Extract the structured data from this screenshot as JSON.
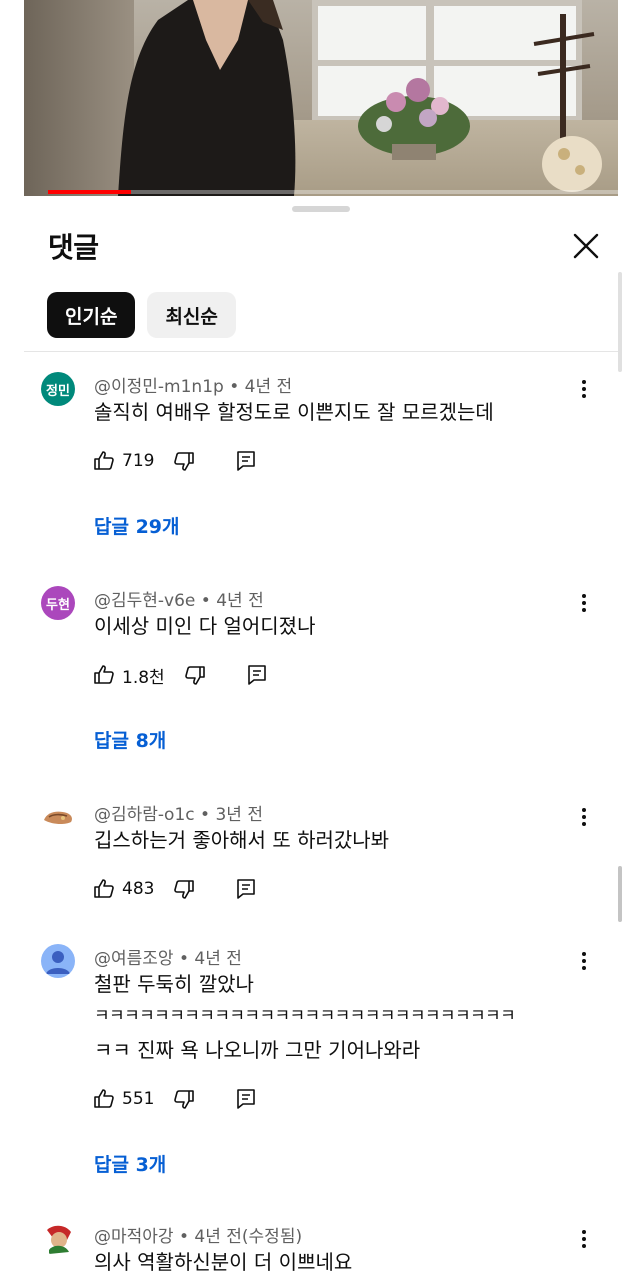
{
  "video": {
    "progress_percent": 14,
    "progress_color": "#ff0000"
  },
  "sheet": {
    "title": "댓글",
    "close_icon": "close-icon"
  },
  "sort_chips": [
    {
      "label": "인기순",
      "active": true
    },
    {
      "label": "최신순",
      "active": false
    }
  ],
  "comments": [
    {
      "avatar_text": "정민",
      "avatar_color": "#00897b",
      "author": "@이정민-m1n1p",
      "time": "4년 전",
      "lines": [
        "솔직히 여배우 할정도로 이쁜지도 잘 모르겠는데"
      ],
      "likes": "719",
      "replies": "답글 29개"
    },
    {
      "avatar_text": "두현",
      "avatar_color": "#ab47bc",
      "author": "@김두현-v6e",
      "time": "4년 전",
      "lines": [
        "이세상 미인 다 얼어디졌나"
      ],
      "likes": "1.8천",
      "replies": "답글 8개"
    },
    {
      "avatar_text": "",
      "avatar_color": "#ffffff",
      "author": "@김하람-o1c",
      "time": "3년 전",
      "lines": [
        "깁스하는거 좋아해서 또 하러갔나봐"
      ],
      "likes": "483",
      "replies": ""
    },
    {
      "avatar_text": "",
      "avatar_color": "#8ab4f8",
      "author": "@여름조앙",
      "time": "4년 전",
      "lines": [
        "철판 두둑히 깔았나",
        "ㅋㅋㅋㅋㅋㅋㅋㅋㅋㅋㅋㅋㅋㅋㅋㅋㅋㅋㅋㅋㅋㅋㅋㅋㅋㅋㅋㅋ",
        "ㅋㅋ 진짜 욕 나오니까 그만 기어나와라"
      ],
      "likes": "551",
      "replies": "답글 3개"
    },
    {
      "avatar_text": "",
      "avatar_color": "#c62828",
      "author": "@마적아강",
      "time": "4년 전(수정됨)",
      "lines": [
        "의사 역활하신분이 더 이쁘네요"
      ],
      "likes": "",
      "replies": ""
    }
  ],
  "icons": {
    "like": "thumbs-up-icon",
    "dislike": "thumbs-down-icon",
    "reply": "reply-comment-icon",
    "more": "more-vertical-icon"
  },
  "colors": {
    "link": "#065fd4",
    "secondary_text": "#606060",
    "chip_active_bg": "#0f0f0f",
    "chip_bg": "#f0f0f0"
  }
}
